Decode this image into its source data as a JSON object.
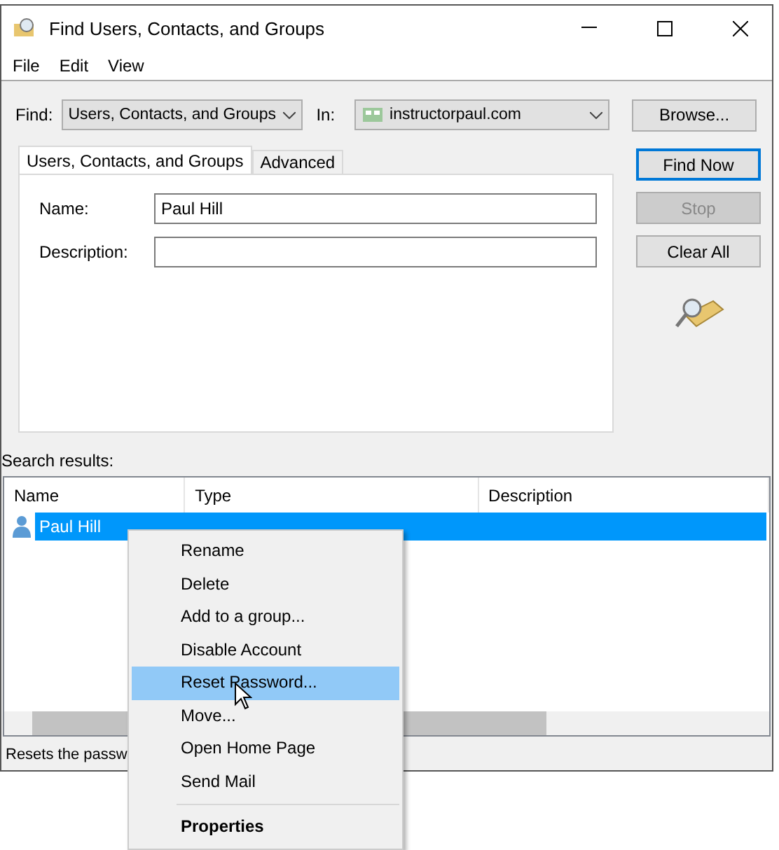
{
  "window": {
    "title": "Find Users, Contacts, and Groups"
  },
  "menu_bar": [
    "File",
    "Edit",
    "View"
  ],
  "find": {
    "label": "Find:",
    "value": "Users, Contacts, and Groups"
  },
  "in": {
    "label": "In:",
    "value": "instructorpaul.com"
  },
  "browse_button": "Browse...",
  "tabs": [
    {
      "label": "Users, Contacts, and Groups",
      "selected": true
    },
    {
      "label": "Advanced",
      "selected": false
    }
  ],
  "fields": [
    {
      "label": "Name:",
      "value": "Paul Hill"
    },
    {
      "label": "Description:"
    }
  ],
  "buttons": [
    {
      "label": "Find Now",
      "disabled": false,
      "default": true
    },
    {
      "label": "Stop",
      "disabled": true,
      "default": false
    },
    {
      "label": "Clear All",
      "disabled": false,
      "default": false
    }
  ],
  "results": {
    "label": "Search results:",
    "columns": [
      "Name",
      "Type",
      "Description"
    ],
    "rows": [
      {
        "name": "Paul Hill",
        "selected": true
      }
    ]
  },
  "status_bar": "Resets the passw",
  "context_menu": [
    {
      "label": "Rename",
      "kind": "item",
      "selected": false,
      "default": false
    },
    {
      "label": "Delete",
      "kind": "item",
      "selected": false,
      "default": false
    },
    {
      "label": "Add to a group...",
      "kind": "item",
      "selected": false,
      "default": false
    },
    {
      "label": "Disable Account",
      "kind": "item",
      "selected": false,
      "default": false
    },
    {
      "label": "Reset Password...",
      "kind": "item",
      "selected": true,
      "default": false
    },
    {
      "label": "Move...",
      "kind": "item",
      "selected": false,
      "default": false
    },
    {
      "label": "Open Home Page",
      "kind": "item",
      "selected": false,
      "default": false
    },
    {
      "label": "Send Mail",
      "kind": "item",
      "selected": false,
      "default": false
    },
    {
      "kind": "separator"
    },
    {
      "label": "Properties",
      "kind": "item",
      "selected": false,
      "default": true
    }
  ]
}
